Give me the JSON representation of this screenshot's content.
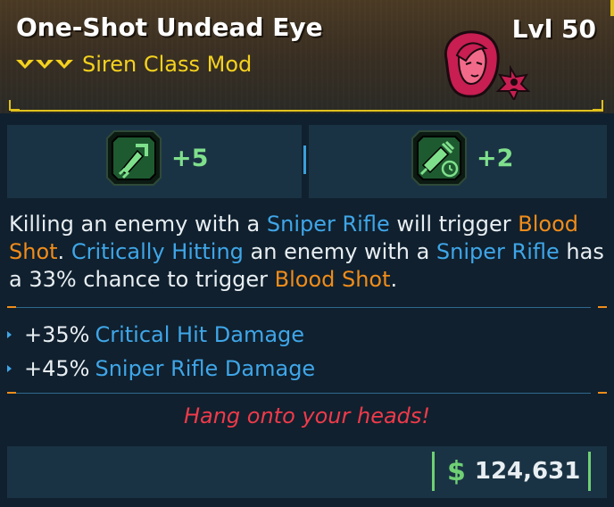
{
  "item": {
    "name": "One-Shot Undead Eye",
    "level_label": "Lvl 50",
    "subtitle": "Siren Class Mod"
  },
  "skills": [
    {
      "icon": "sniper-skill-icon",
      "value": "+5"
    },
    {
      "icon": "syringe-timer-skill-icon",
      "value": "+2"
    }
  ],
  "description": {
    "p1": "Killing an enemy with a ",
    "k1": "Sniper Rifle",
    "p2": " will trigger ",
    "k2": "Blood Shot",
    "p3": ". ",
    "k3": "Critically Hitting",
    "p4": " an enemy with a ",
    "k4": "Sniper Rifle",
    "p5": " has a 33% chance to trigger ",
    "k5": "Blood Shot",
    "p6": "."
  },
  "stats": [
    {
      "value": "+35%",
      "label": "Critical Hit Damage"
    },
    {
      "value": "+45%",
      "label": "Sniper Rifle Damage"
    }
  ],
  "flavor_text": "Hang onto your heads!",
  "price": {
    "icon": "dollar-icon",
    "symbol": "$",
    "value": "124,631"
  },
  "colors": {
    "rarity": "#f4d21e",
    "keyword_blue": "#3fa6e8",
    "keyword_orange": "#f08c1a",
    "flavor_red": "#f03a4a",
    "money_green": "#6fd074"
  }
}
